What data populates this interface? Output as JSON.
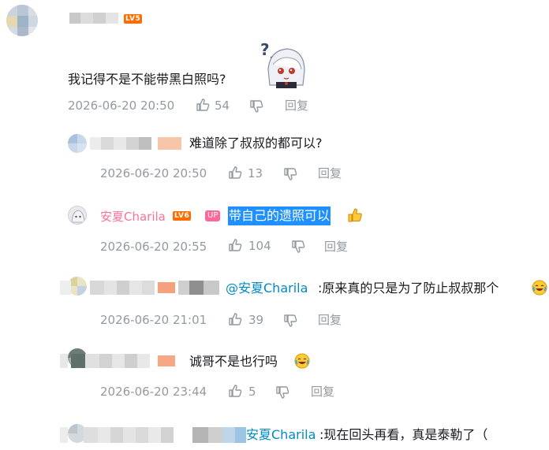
{
  "comments": [
    {
      "text": "我记得不是不能带黑白照吗?",
      "time": "2026-06-20 20:50",
      "likes": "54",
      "reply": "回复",
      "level_badge": "LV5"
    },
    {
      "text": "难道除了叔叔的都可以?",
      "time": "2026-06-20 20:50",
      "likes": "13",
      "reply": "回复"
    },
    {
      "username": "安夏Charila",
      "level_badge": "LV6",
      "up_badge": "UP",
      "text": "带自己的遗照可以",
      "time": "2026-06-20 20:55",
      "likes": "104",
      "reply": "回复"
    },
    {
      "mention": "@安夏Charila",
      "text": ":原来真的只是为了防止叔叔那个",
      "time": "2026-06-20 21:01",
      "likes": "39",
      "reply": "回复"
    },
    {
      "text": "诚哥不是也行吗",
      "time": "2026-06-20 23:44",
      "likes": "5",
      "reply": "回复"
    },
    {
      "mention": "安夏Charila",
      "text": ":现在回头再看，真是泰勒了（"
    }
  ]
}
